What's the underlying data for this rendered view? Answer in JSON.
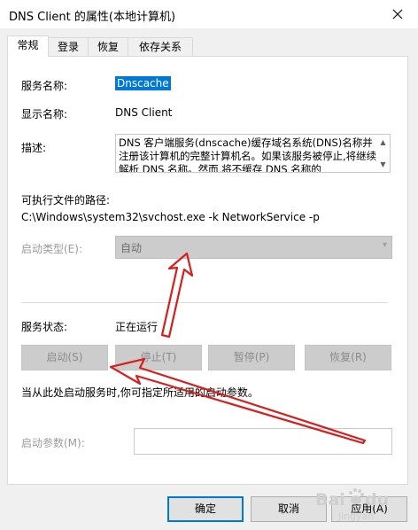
{
  "window": {
    "title": "DNS Client 的属性(本地计算机)"
  },
  "tabs": [
    {
      "label": "常规",
      "active": true
    },
    {
      "label": "登录",
      "active": false
    },
    {
      "label": "恢复",
      "active": false
    },
    {
      "label": "依存关系",
      "active": false
    }
  ],
  "general": {
    "service_name_label": "服务名称:",
    "service_name_value": "Dnscache",
    "display_name_label": "显示名称:",
    "display_name_value": "DNS Client",
    "description_label": "描述:",
    "description_value": "DNS 客户端服务(dnscache)缓存域名系统(DNS)名称并注册该计算机的完整计算机名。如果该服务被停止,将继续解析 DNS 名称。然而,将不缓存 DNS 名称的",
    "exe_path_label": "可执行文件的路径:",
    "exe_path_value": "C:\\Windows\\system32\\svchost.exe -k NetworkService -p",
    "startup_type_label": "启动类型(E):",
    "startup_type_value": "自动",
    "service_status_label": "服务状态:",
    "service_status_value": "正在运行",
    "buttons": {
      "start": "启动(S)",
      "stop": "停止(T)",
      "pause": "暂停(P)",
      "resume": "恢复(R)"
    },
    "hint_text": "当从此处启动服务时,你可指定所适用的启动参数。",
    "start_params_label": "启动参数(M):",
    "start_params_value": ""
  },
  "footer": {
    "ok": "确定",
    "cancel": "取消",
    "apply": "应用(A)"
  },
  "watermark": {
    "brand": "Bai",
    "brand_suffix": "du",
    "sub": "jingyan"
  },
  "colors": {
    "accent": "#0078d7",
    "annotation_arrow": "#d81e1e"
  }
}
